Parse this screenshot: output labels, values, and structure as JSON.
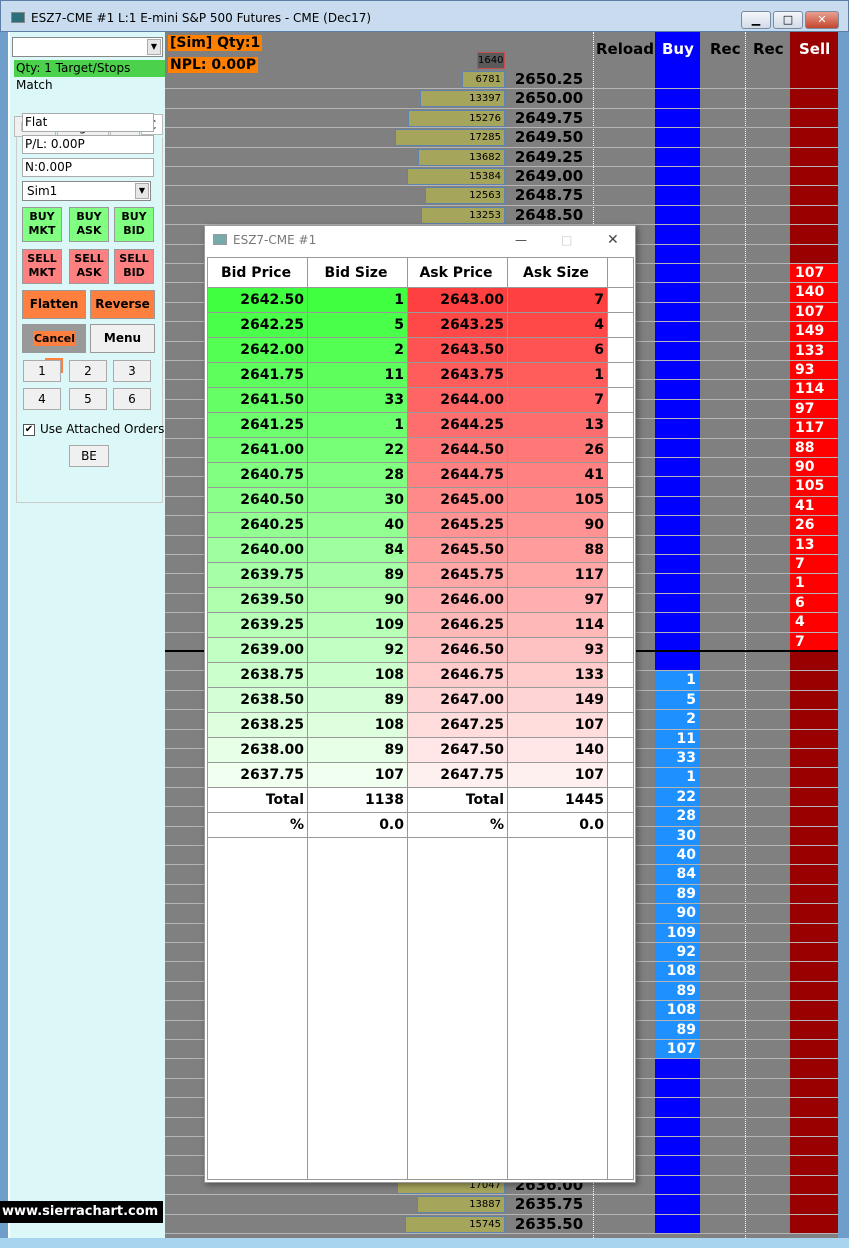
{
  "window": {
    "title": "ESZ7-CME  #1  L:1  E-mini S&P 500 Futures - CME (Dec17)",
    "minimize": "▁",
    "maximize": "□",
    "close": "✕"
  },
  "left": {
    "status": "Qty: 1 Target/Stops Match",
    "tabs": [
      "Main",
      "Targets",
      "Set",
      "C"
    ],
    "position": "Flat",
    "pl": "P/L: 0.00P",
    "npl": "N:0.00P",
    "account": "Sim1",
    "buy": [
      "BUY\nMKT",
      "BUY\nASK",
      "BUY\nBID"
    ],
    "sell": [
      "SELL\nMKT",
      "SELL\nASK",
      "SELL\nBID"
    ],
    "flatten": "Flatten",
    "reverse": "Reverse",
    "cancel_all": "Cancel All",
    "menu": "Menu",
    "qty_buttons": [
      "1",
      "2",
      "3",
      "4",
      "5",
      "6"
    ],
    "use_attached": "Use Attached Orders",
    "use_attached_checked": true,
    "be": "BE",
    "logo": "www.sierrachart.com"
  },
  "overlay": {
    "line1": "[Sim]  Qty:1",
    "line2": "NPL: 0.00P"
  },
  "ladder": {
    "headers": {
      "reload": "Reload",
      "buy": "Buy",
      "rec1": "Rec",
      "rec2": "Rec",
      "sell": "Sell"
    },
    "header_volume": "1640",
    "top_price": 2650.25,
    "tick": 0.25,
    "row_count": 60,
    "last_trade_between": [
      "2643.00",
      "2642.75"
    ],
    "volume_rows": [
      {
        "price": "2650.25",
        "volume": 6781
      },
      {
        "price": "2650.00",
        "volume": 13397
      },
      {
        "price": "2649.75",
        "volume": 15276
      },
      {
        "price": "2649.50",
        "volume": 17285
      },
      {
        "price": "2649.25",
        "volume": 13682
      },
      {
        "price": "2649.00",
        "volume": 15384
      },
      {
        "price": "2648.75",
        "volume": 12563
      },
      {
        "price": "2648.50",
        "volume": 13253
      },
      {
        "price": "2636.00",
        "volume": 17047
      },
      {
        "price": "2635.75",
        "volume": 13887
      },
      {
        "price": "2635.50",
        "volume": 15745
      }
    ],
    "sell": [
      {
        "price": "2647.75",
        "size": 107
      },
      {
        "price": "2647.50",
        "size": 140
      },
      {
        "price": "2647.25",
        "size": 107
      },
      {
        "price": "2647.00",
        "size": 149
      },
      {
        "price": "2646.75",
        "size": 133
      },
      {
        "price": "2646.50",
        "size": 93
      },
      {
        "price": "2646.25",
        "size": 114
      },
      {
        "price": "2646.00",
        "size": 97
      },
      {
        "price": "2645.75",
        "size": 117
      },
      {
        "price": "2645.50",
        "size": 88
      },
      {
        "price": "2645.25",
        "size": 90
      },
      {
        "price": "2645.00",
        "size": 105
      },
      {
        "price": "2644.75",
        "size": 41
      },
      {
        "price": "2644.50",
        "size": 26
      },
      {
        "price": "2644.25",
        "size": 13
      },
      {
        "price": "2644.00",
        "size": 7
      },
      {
        "price": "2643.75",
        "size": 1
      },
      {
        "price": "2643.50",
        "size": 6
      },
      {
        "price": "2643.25",
        "size": 4
      },
      {
        "price": "2643.00",
        "size": 7
      }
    ],
    "buy": [
      {
        "price": "2642.50",
        "size": 1
      },
      {
        "price": "2642.25",
        "size": 5
      },
      {
        "price": "2642.00",
        "size": 2
      },
      {
        "price": "2641.75",
        "size": 11
      },
      {
        "price": "2641.50",
        "size": 33
      },
      {
        "price": "2641.25",
        "size": 1
      },
      {
        "price": "2641.00",
        "size": 22
      },
      {
        "price": "2640.75",
        "size": 28
      },
      {
        "price": "2640.50",
        "size": 30
      },
      {
        "price": "2640.25",
        "size": 40
      },
      {
        "price": "2640.00",
        "size": 84
      },
      {
        "price": "2639.75",
        "size": 89
      },
      {
        "price": "2639.50",
        "size": 90
      },
      {
        "price": "2639.25",
        "size": 109
      },
      {
        "price": "2639.00",
        "size": 92
      },
      {
        "price": "2638.75",
        "size": 108
      },
      {
        "price": "2638.50",
        "size": 89
      },
      {
        "price": "2638.25",
        "size": 108
      },
      {
        "price": "2638.00",
        "size": 89
      },
      {
        "price": "2637.75",
        "size": 107
      }
    ]
  },
  "popup": {
    "title": "ESZ7-CME  #1",
    "columns": [
      "Bid Price",
      "Bid Size",
      "Ask Price",
      "Ask Size"
    ],
    "rows": [
      [
        "2642.50",
        "1",
        "2643.00",
        "7"
      ],
      [
        "2642.25",
        "5",
        "2643.25",
        "4"
      ],
      [
        "2642.00",
        "2",
        "2643.50",
        "6"
      ],
      [
        "2641.75",
        "11",
        "2643.75",
        "1"
      ],
      [
        "2641.50",
        "33",
        "2644.00",
        "7"
      ],
      [
        "2641.25",
        "1",
        "2644.25",
        "13"
      ],
      [
        "2641.00",
        "22",
        "2644.50",
        "26"
      ],
      [
        "2640.75",
        "28",
        "2644.75",
        "41"
      ],
      [
        "2640.50",
        "30",
        "2645.00",
        "105"
      ],
      [
        "2640.25",
        "40",
        "2645.25",
        "90"
      ],
      [
        "2640.00",
        "84",
        "2645.50",
        "88"
      ],
      [
        "2639.75",
        "89",
        "2645.75",
        "117"
      ],
      [
        "2639.50",
        "90",
        "2646.00",
        "97"
      ],
      [
        "2639.25",
        "109",
        "2646.25",
        "114"
      ],
      [
        "2639.00",
        "92",
        "2646.50",
        "93"
      ],
      [
        "2638.75",
        "108",
        "2646.75",
        "133"
      ],
      [
        "2638.50",
        "89",
        "2647.00",
        "149"
      ],
      [
        "2638.25",
        "108",
        "2647.25",
        "107"
      ],
      [
        "2638.00",
        "89",
        "2647.50",
        "140"
      ],
      [
        "2637.75",
        "107",
        "2647.75",
        "107"
      ]
    ],
    "total": [
      "Total",
      "1138",
      "Total",
      "1445"
    ],
    "percent": [
      "%",
      "0.0",
      "%",
      "0.0"
    ]
  },
  "colors": {
    "bid": "#40ff40",
    "ask": "#ff4040",
    "buy_col": "#0000ff",
    "buy_size": "#1e90ff",
    "sell_col": "#990000",
    "sell_size": "#ff0000",
    "overlay": "#ff8000"
  }
}
